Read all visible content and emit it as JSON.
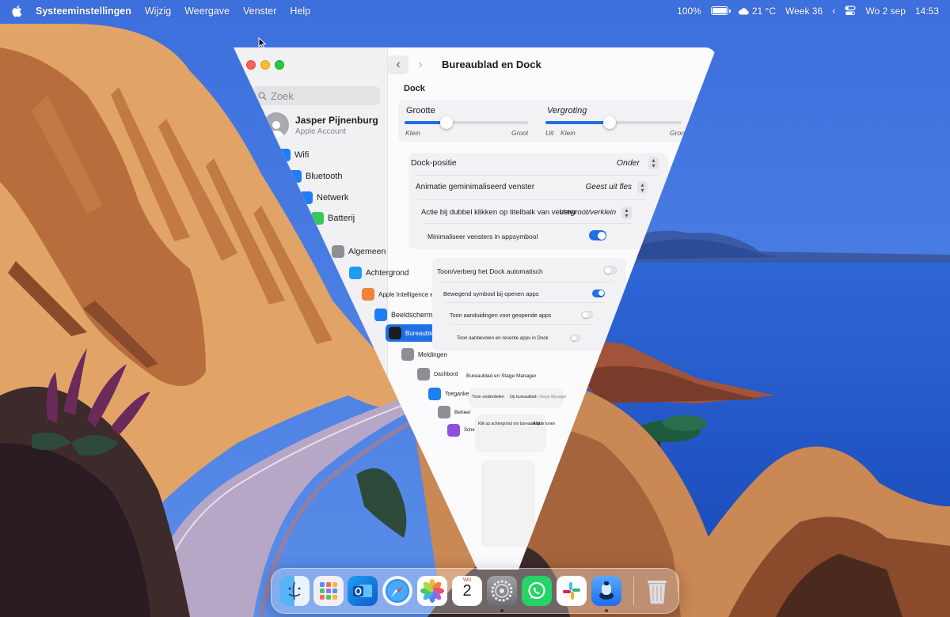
{
  "menubar": {
    "app": "Systeeminstellingen",
    "menus": [
      "Wijzig",
      "Weergave",
      "Venster",
      "Help"
    ],
    "battery": "100%",
    "weather": "21 °C",
    "week": "Week 36",
    "date": "Wo 2 sep",
    "time": "14:53"
  },
  "window": {
    "title": "Bureaublad en Dock",
    "search_placeholder": "Zoek",
    "account": {
      "name": "Jasper Pijnenburg",
      "sub": "Apple Account"
    },
    "sidebar": [
      {
        "label": "Wifi",
        "icon": "wifi-icon",
        "color": "#1f7ff2"
      },
      {
        "label": "Bluetooth",
        "icon": "bluetooth-icon",
        "color": "#1f7ff2"
      },
      {
        "label": "Netwerk",
        "icon": "globe-icon",
        "color": "#1f7ff2"
      },
      {
        "label": "Batterij",
        "icon": "battery-icon",
        "color": "#34c759"
      },
      {
        "label": "Algemeen",
        "icon": "gear-icon",
        "color": "#8e8e93"
      },
      {
        "label": "Achtergrond",
        "icon": "wallpaper-icon",
        "color": "#1f9bf0"
      },
      {
        "label": "Apple Intelligence en Siri",
        "icon": "siri-icon",
        "color": "#f0833a"
      },
      {
        "label": "Beeldschermen",
        "icon": "display-icon",
        "color": "#1f7ff2"
      },
      {
        "label": "Bureaublad en Dock",
        "icon": "dock-icon",
        "color": "#1d1d1f"
      },
      {
        "label": "Meldingen",
        "icon": "bell-icon",
        "color": "#8e8e93"
      },
      {
        "label": "Dashbord",
        "icon": "grid-icon",
        "color": "#8e8e93"
      },
      {
        "label": "Toegankelijkheid",
        "icon": "accessibility-icon",
        "color": "#1f7ff2"
      },
      {
        "label": "Beheer",
        "icon": "screen-icon",
        "color": "#8e8e93"
      },
      {
        "label": "Schermtijd",
        "icon": "hourglass-icon",
        "color": "#8e4fe0"
      }
    ],
    "dock_section": "Dock",
    "size_label": "Grootte",
    "size_value": 0.34,
    "size_min": "Klein",
    "size_max": "Groot",
    "mag_label": "Vergroting",
    "mag_value": 0.47,
    "mag_off": "Uit",
    "mag_min": "Klein",
    "mag_max": "Groot",
    "rows": [
      {
        "label": "Dock-positie",
        "value": "Onder"
      },
      {
        "label": "Animatie geminimaliseerd venster",
        "value": "Geest uit fles"
      },
      {
        "label": "Actie bij dubbel klikken op titelbalk van venster",
        "value": "Vergroot/verklein"
      },
      {
        "label": "Minimaliseer vensters in appsymbool",
        "value": true
      }
    ],
    "toggles": [
      {
        "label": "Toon/verberg het Dock automatisch",
        "value": false
      },
      {
        "label": "Bewegend symbool bij openen apps",
        "value": true
      },
      {
        "label": "Toon aanduidingen voor geopende apps",
        "value": false
      },
      {
        "label": "Toon aanbevolen en recente apps in Dock",
        "value": false
      }
    ],
    "desktop_section": "Bureaublad en Stage Manager",
    "show_items_label": "Toon onderdelen",
    "show_items_opts": [
      "Op bureaublad",
      "In Stage Manager"
    ],
    "click_wallpaper_label": "Klik op achtergrond om bureaublad te tonen",
    "click_wallpaper_value": "Altijd"
  },
  "dock": {
    "apps": [
      {
        "name": "Finder",
        "icon": "finder-icon"
      },
      {
        "name": "Launchpad",
        "icon": "launchpad-icon"
      },
      {
        "name": "Outlook",
        "icon": "outlook-icon"
      },
      {
        "name": "Safari",
        "icon": "safari-icon"
      },
      {
        "name": "Foto's",
        "icon": "photos-icon"
      },
      {
        "name": "Agenda",
        "icon": "calendar-icon"
      },
      {
        "name": "Systeeminstellingen",
        "icon": "system-settings-icon"
      },
      {
        "name": "WhatsApp",
        "icon": "whatsapp-icon"
      },
      {
        "name": "Slack",
        "icon": "slack-icon"
      },
      {
        "name": "Pages",
        "icon": "pages-icon"
      },
      {
        "name": "Prullenmand",
        "icon": "trash-icon"
      }
    ],
    "calendar_month": "Wo",
    "calendar_day": "2"
  }
}
